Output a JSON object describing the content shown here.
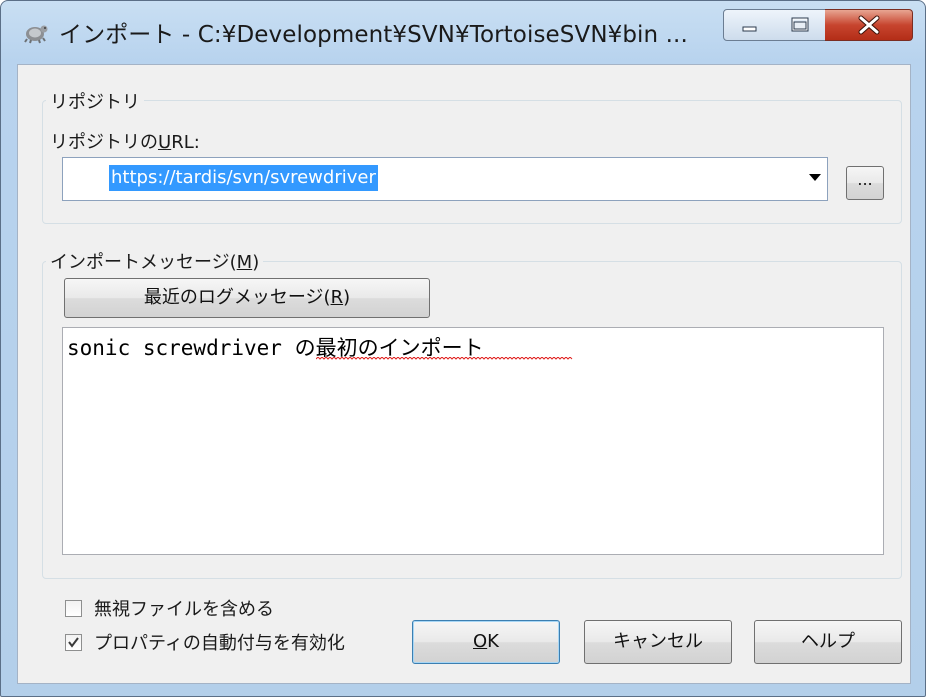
{
  "window": {
    "title": "インポート - C:¥Development¥SVN¥TortoiseSVN¥bin ..."
  },
  "repository_group": {
    "title": "リポジトリ",
    "url_label_pre": "リポジトリの",
    "url_label_accel": "U",
    "url_label_post": "RL:",
    "url_value": "https://tardis/svn/svrewdriver",
    "browse_label": "..."
  },
  "message_group": {
    "title_pre": "インポートメッセージ(",
    "title_accel": "M",
    "title_post": ")",
    "recent_pre": "最近のログメッセージ(",
    "recent_accel": "R",
    "recent_post": ")",
    "message_ascii": "sonic screwdriver ",
    "message_jp": "の最初のインポート"
  },
  "options": {
    "include_ignored_label": "無視ファイルを含める",
    "include_ignored_checked": false,
    "auto_props_label": "プロパティの自動付与を有効化",
    "auto_props_checked": true
  },
  "buttons": {
    "ok_accel": "O",
    "ok_post": "K",
    "cancel": "キャンセル",
    "help": "ヘルプ"
  },
  "colors": {
    "selection": "#3399ff",
    "spellcheck_underline": "#e0201e",
    "title_gradient_top": "#c9dff3"
  },
  "icons": {
    "app": "tortoise-icon",
    "minimize": "minimize-icon",
    "maximize": "maximize-icon",
    "close": "close-icon",
    "dropdown": "chevron-down-icon",
    "check": "checkmark-icon"
  }
}
